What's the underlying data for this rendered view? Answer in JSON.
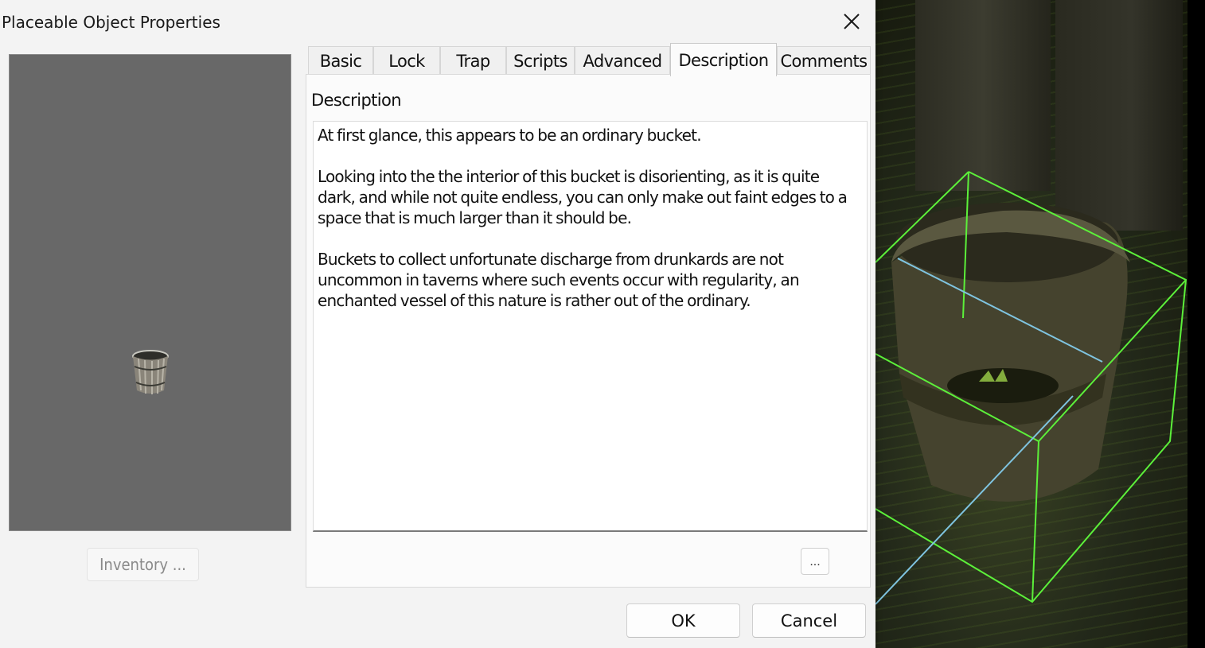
{
  "window": {
    "title": "Placeable Object Properties"
  },
  "icons": {
    "close": "close-icon",
    "preview": "bucket-icon"
  },
  "preview": {
    "inventory_label": "Inventory ..."
  },
  "tabs": [
    {
      "label": "Basic"
    },
    {
      "label": "Lock"
    },
    {
      "label": "Trap"
    },
    {
      "label": "Scripts"
    },
    {
      "label": "Advanced"
    },
    {
      "label": "Description",
      "active": true
    },
    {
      "label": "Comments"
    }
  ],
  "description_tab": {
    "field_label": "Description",
    "text": "At first glance, this appears to be an ordinary bucket.\n\nLooking into the the interior of this bucket is disorienting, as it is quite\ndark, and while not quite endless, you can only make out faint edges to a\nspace that is much larger than it should be.\n\nBuckets to collect unfortunate discharge from drunkards are not\nuncommon in taverns where such events occur with regularity, an\nenchanted vessel of this nature is rather out of the ordinary.",
    "edit_button_label": "..."
  },
  "footer": {
    "ok_label": "OK",
    "cancel_label": "Cancel"
  },
  "colors": {
    "dialog_bg": "#f3f3f3",
    "preview_bg": "#686868",
    "selection_box": "#5cf03a",
    "axis_line": "#7fc4e0"
  }
}
